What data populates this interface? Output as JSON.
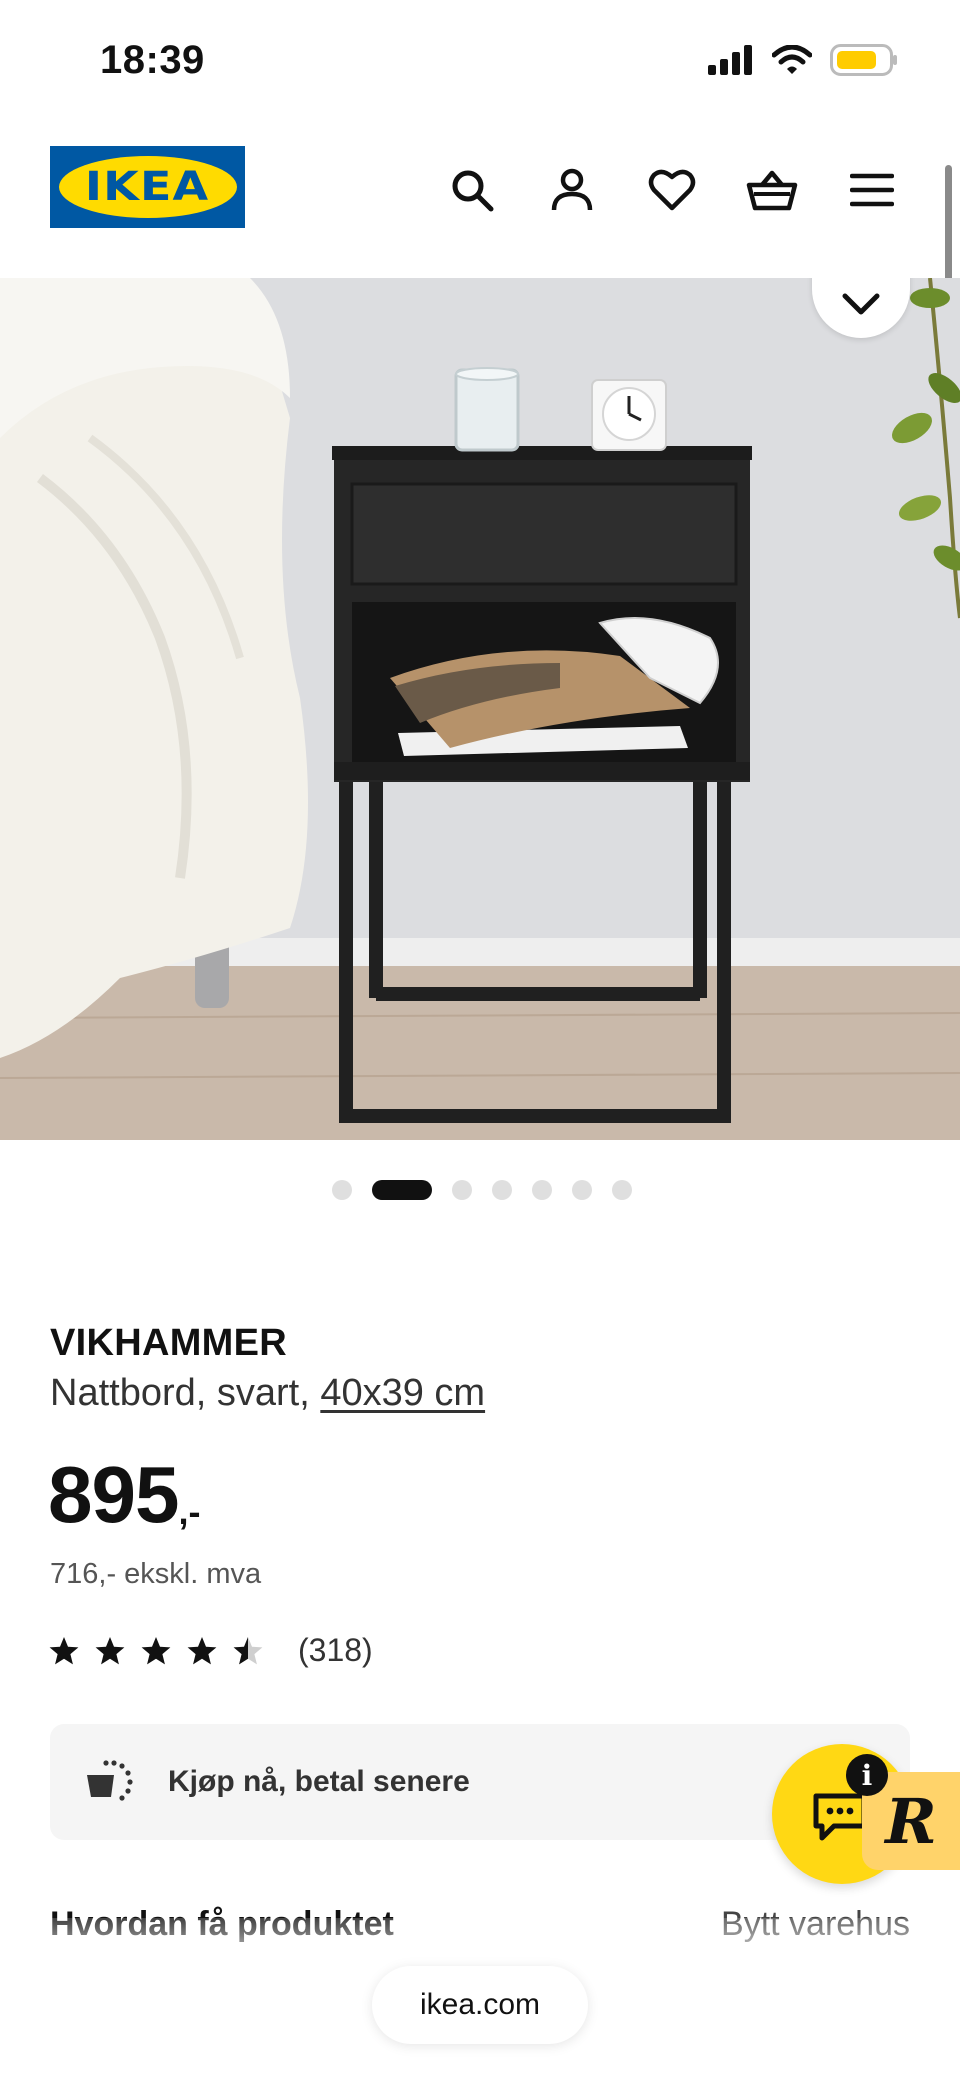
{
  "status_bar": {
    "time": "18:39",
    "icons": [
      "cellular-signal-icon",
      "wifi-icon",
      "battery-icon"
    ],
    "battery_color": "#ffcc00"
  },
  "header": {
    "logo_text": "IKEA",
    "icons": [
      "search-icon",
      "account-icon",
      "heart-icon",
      "cart-icon",
      "menu-icon"
    ]
  },
  "gallery": {
    "image_count": 7,
    "active_index": 1,
    "collapse_icon": "chevron-down-icon"
  },
  "product": {
    "name": "VIKHAMMER",
    "description": "Nattbord, svart, ",
    "size_link": "40x39 cm",
    "price_main": "895",
    "price_suffix": ",-",
    "price_ex_vat": "716,- ekskl. mva",
    "rating_value": 4.5,
    "rating_max": 5,
    "rating_count": "(318)"
  },
  "pay_later": {
    "label": "Kjøp nå, betal senere",
    "icon": "pay-later-icon"
  },
  "chat": {
    "badge": "i",
    "tab_letter": "R",
    "icon": "chat-icon",
    "color": "#ffd814"
  },
  "delivery": {
    "heading": "Hvordan få produktet",
    "change_store": "Bytt varehus"
  },
  "browser": {
    "url": "ikea.com"
  },
  "colors": {
    "ikea_blue": "#0058a3",
    "ikea_yellow": "#ffdb00"
  }
}
